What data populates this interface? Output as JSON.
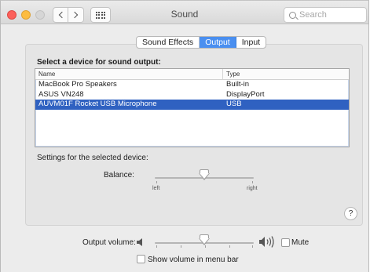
{
  "window": {
    "title": "Sound"
  },
  "toolbar": {
    "search_placeholder": "Search"
  },
  "tabs": [
    {
      "label": "Sound Effects",
      "active": false
    },
    {
      "label": "Output",
      "active": true
    },
    {
      "label": "Input",
      "active": false
    }
  ],
  "device_section": {
    "heading": "Select a device for sound output:",
    "columns": [
      "Name",
      "Type"
    ],
    "rows": [
      {
        "name": "MacBook Pro Speakers",
        "type": "Built-in",
        "selected": false
      },
      {
        "name": "ASUS VN248",
        "type": "DisplayPort",
        "selected": false
      },
      {
        "name": "AUVM01F Rocket USB Microphone",
        "type": "USB",
        "selected": true
      }
    ]
  },
  "settings": {
    "label": "Settings for the selected device:",
    "balance_label": "Balance:",
    "balance_left": "left",
    "balance_right": "right",
    "balance_value": 0.5
  },
  "help_label": "?",
  "output": {
    "volume_label": "Output volume:",
    "volume_value": 0.5,
    "mute_label": "Mute",
    "mute_checked": false,
    "show_in_menu_bar_label": "Show volume in menu bar",
    "show_in_menu_bar_checked": false
  },
  "colors": {
    "accent": "#4a8ff0",
    "selection": "#2f61c1"
  }
}
